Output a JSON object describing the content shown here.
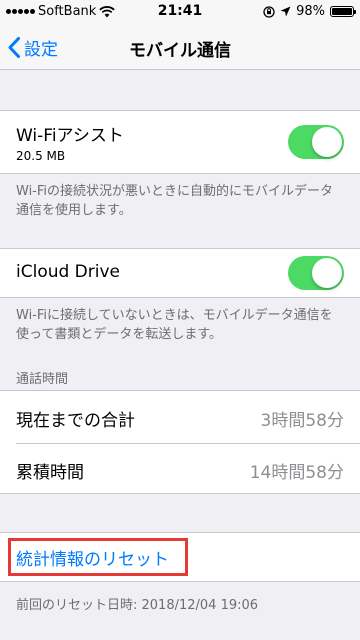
{
  "status": {
    "carrier": "SoftBank",
    "time": "21:41",
    "battery_text": "98%",
    "battery_level": 0.98
  },
  "nav": {
    "back_label": "設定",
    "title": "モバイル通信"
  },
  "wifi_assist": {
    "label": "Wi-Fiアシスト",
    "data_used": "20.5 MB",
    "enabled": true,
    "footer": "Wi-Fiの接続状況が悪いときに自動的にモバイルデータ通信を使用します。"
  },
  "icloud_drive": {
    "label": "iCloud Drive",
    "enabled": true,
    "footer": "Wi-Fiに接続していないときは、モバイルデータ通信を使って書類とデータを転送します。"
  },
  "call_time": {
    "header": "通話時間",
    "rows": [
      {
        "label": "現在までの合計",
        "value": "3時間58分"
      },
      {
        "label": "累積時間",
        "value": "14時間58分"
      }
    ]
  },
  "reset": {
    "label": "統計情報のリセット",
    "last_reset": "前回のリセット日時: 2018/12/04 19:06"
  },
  "colors": {
    "accent": "#007aff",
    "toggle_on": "#4cd964",
    "highlight": "#e53935"
  }
}
